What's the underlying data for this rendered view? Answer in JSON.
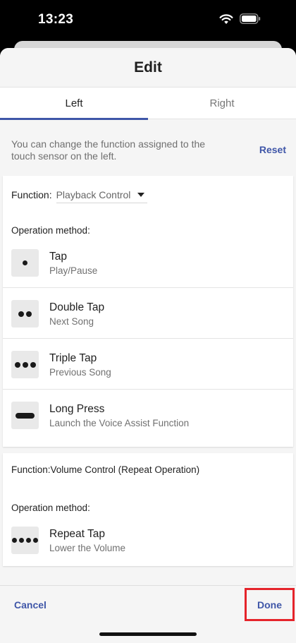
{
  "status_bar": {
    "time": "13:23",
    "icons": [
      "wifi-icon",
      "battery-icon"
    ]
  },
  "sheet": {
    "title": "Edit"
  },
  "tabs": [
    {
      "label": "Left",
      "selected": true
    },
    {
      "label": "Right",
      "selected": false
    }
  ],
  "info": {
    "text": "You can change the function assigned to the touch sensor on the left.",
    "reset_label": "Reset"
  },
  "card1": {
    "function_label": "Function:",
    "function_value": "Playback Control",
    "operation_label": "Operation method:",
    "operations": [
      {
        "icon": "single-dot-icon",
        "title": "Tap",
        "subtitle": "Play/Pause"
      },
      {
        "icon": "double-dot-icon",
        "title": "Double Tap",
        "subtitle": "Next Song"
      },
      {
        "icon": "triple-dot-icon",
        "title": "Triple Tap",
        "subtitle": "Previous Song"
      },
      {
        "icon": "long-press-bar-icon",
        "title": "Long Press",
        "subtitle": "Launch the Voice Assist Function"
      }
    ]
  },
  "card2": {
    "function_label": "Function:Volume Control (Repeat Operation)",
    "operation_label": "Operation method:",
    "operations": [
      {
        "icon": "repeat-dots-icon",
        "title": "Repeat Tap",
        "subtitle": "Lower the Volume"
      }
    ]
  },
  "bottom_bar": {
    "cancel_label": "Cancel",
    "done_label": "Done"
  },
  "colors": {
    "accent": "#3f56a8",
    "highlight_box": "#e5242b",
    "background": "#f5f5f5"
  }
}
